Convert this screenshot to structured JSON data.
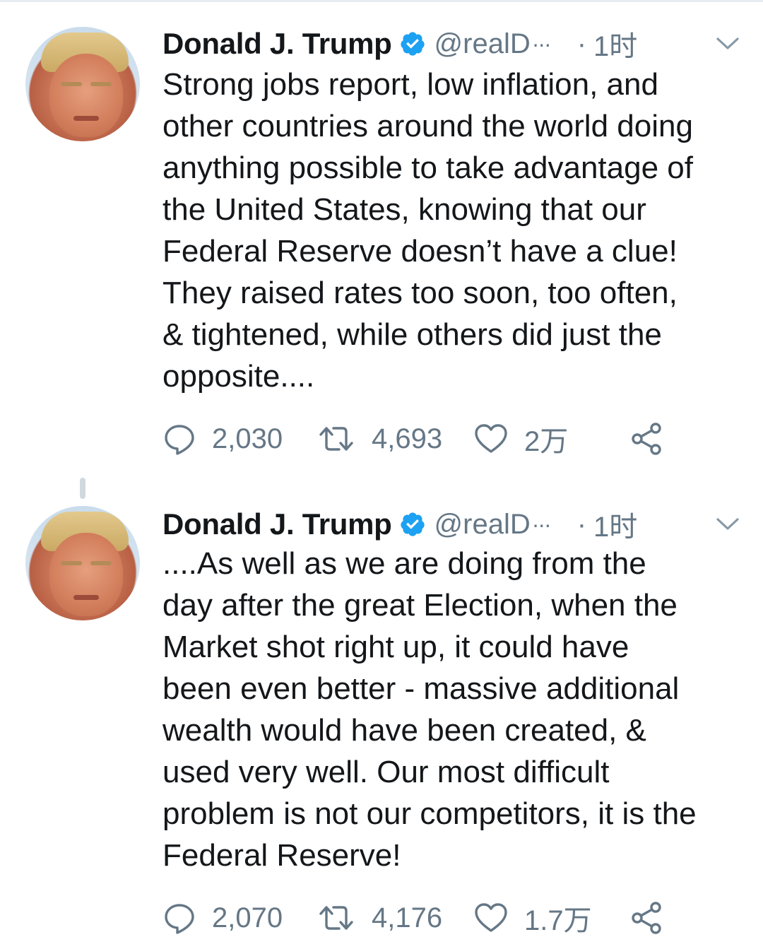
{
  "tweets": [
    {
      "author": {
        "name": "Donald J. Trump",
        "handle": "@realD",
        "truncation": "···",
        "verified": true
      },
      "separator": "·",
      "time": "1时",
      "text": "Strong jobs report, low inflation, and\nother countries around the world doing\nanything possible to take advantage of\nthe United States, knowing that our\nFederal Reserve doesn’t have a clue!\nThey raised rates too soon, too often,\n& tightened, while others did just the\nopposite....",
      "stats": {
        "replies": "2,030",
        "retweets": "4,693",
        "likes": "2万"
      }
    },
    {
      "author": {
        "name": "Donald J. Trump",
        "handle": "@realD",
        "truncation": "···",
        "verified": true
      },
      "separator": "·",
      "time": "1时",
      "text": "....As well as we are doing from the\nday after the great Election, when the\nMarket shot right up, it could have\nbeen even better - massive additional\nwealth would have been created, &\nused very well. Our most difficult\nproblem is not our competitors, it is the\nFederal Reserve!",
      "stats": {
        "replies": "2,070",
        "retweets": "4,176",
        "likes": "1.7万"
      }
    }
  ],
  "icons": {
    "verified": "verified-badge-icon",
    "menu": "chevron-down-icon",
    "reply": "reply-bubble-icon",
    "retweet": "retweet-icon",
    "like": "heart-icon",
    "share": "share-icon"
  },
  "colors": {
    "text": "#14171a",
    "secondary": "#657786",
    "verified": "#1da1f2",
    "thread_line": "#cfd9de"
  }
}
